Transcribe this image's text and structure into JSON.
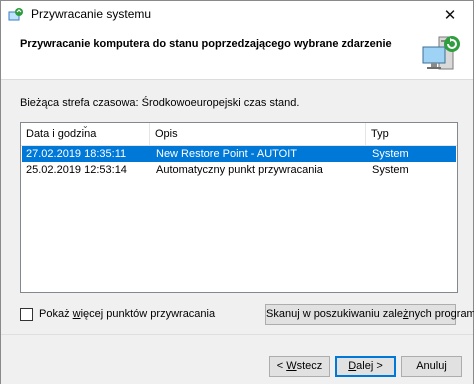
{
  "window": {
    "title": "Przywracanie systemu"
  },
  "header": {
    "title": "Przywracanie komputera do stanu poprzedzającego wybrane zdarzenie"
  },
  "timezone_text": "Bieżąca strefa czasowa: Środkowoeuropejski czas stand.",
  "table": {
    "columns": [
      "Data i godzina",
      "Opis",
      "Typ"
    ],
    "rows": [
      {
        "date": "27.02.2019 18:35:11",
        "desc": "New Restore Point - AUTOIT",
        "type": "System",
        "selected": true
      },
      {
        "date": "25.02.2019 12:53:14",
        "desc": "Automatyczny punkt przywracania",
        "type": "System",
        "selected": false
      }
    ]
  },
  "checkbox": {
    "label_pre": "Pokaż ",
    "label_key": "w",
    "label_post": "ięcej punktów przywracania",
    "checked": false
  },
  "scan_button": {
    "pre": "Skanuj w poszukiwaniu zale",
    "key": "ż",
    "post": "nych programów"
  },
  "buttons": {
    "back": {
      "pre": "< ",
      "key": "W",
      "post": "stecz"
    },
    "next": {
      "pre": "",
      "key": "D",
      "post": "alej >"
    },
    "cancel": "Anuluj"
  },
  "colors": {
    "selection": "#0078d7",
    "dialog_bg": "#f0f0f0"
  }
}
